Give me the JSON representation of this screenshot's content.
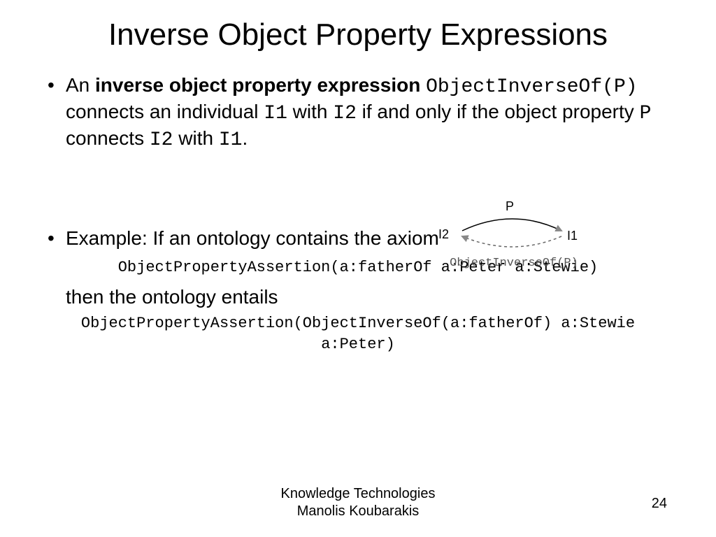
{
  "title": "Inverse Object Property Expressions",
  "bullet1": {
    "pre": "An ",
    "bold": "inverse object property expression",
    "code1": "ObjectInverseOf(P)",
    "mid1": " connects an individual ",
    "i1": "I1",
    "mid2": " with ",
    "i2": "I2",
    "mid3": " if and only if the object property ",
    "p": "P",
    "mid4": " connects ",
    "i2b": "I2",
    "mid5": " with ",
    "i1b": "I1",
    "end": "."
  },
  "bullet2": {
    "text": "Example: If an ontology contains the axiom",
    "code1": "ObjectPropertyAssertion(a:fatherOf a:Peter a:Stewie)",
    "then": "then the ontology entails",
    "code2a": "ObjectPropertyAssertion(ObjectInverseOf(a:fatherOf) a:Stewie",
    "code2b": "a:Peter)"
  },
  "diagram": {
    "i2": "I2",
    "i1": "I1",
    "p": "P",
    "caption": "ObjectInverseOf(P)"
  },
  "footer": {
    "line1": "Knowledge Technologies",
    "line2": "Manolis Koubarakis"
  },
  "page": "24"
}
